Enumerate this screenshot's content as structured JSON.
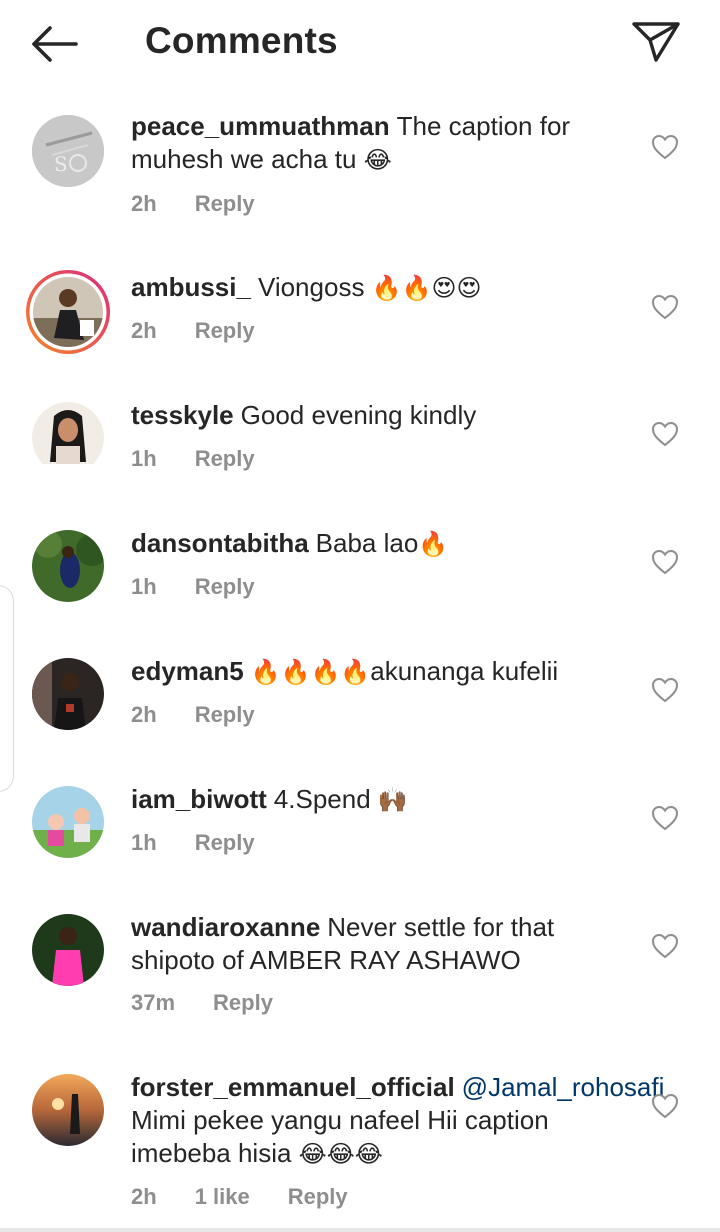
{
  "header": {
    "title": "Comments"
  },
  "comments": [
    {
      "username": "peace_ummuathman",
      "text": "The caption for muhesh we acha tu",
      "emoji": "😂",
      "time": "2h",
      "reply": "Reply"
    },
    {
      "username": "ambussi_",
      "text": "Viongoss",
      "emoji": "🔥🔥😍😍",
      "time": "2h",
      "reply": "Reply"
    },
    {
      "username": "tesskyle",
      "text": "Good evening kindly",
      "emoji": "",
      "time": "1h",
      "reply": "Reply"
    },
    {
      "username": "dansontabitha",
      "text": "Baba lao",
      "emoji": "🔥",
      "time": "1h",
      "reply": "Reply"
    },
    {
      "username": "edyman5",
      "emoji_before": "🔥🔥🔥🔥",
      "text": "akunanga kufelii",
      "time": "2h",
      "reply": "Reply"
    },
    {
      "username": "iam_biwott",
      "text": "4.Spend",
      "emoji": "🙌🏾",
      "time": "1h",
      "reply": "Reply"
    },
    {
      "username": "wandiaroxanne",
      "text": "Never settle  for that shipoto of  AMBER RAY ASHAWO",
      "emoji": "",
      "time": "37m",
      "reply": "Reply"
    },
    {
      "username": "forster_emmanuel_official",
      "mention": "@Jamal_rohosafi",
      "text": "Mimi pekee yangu nafeel Hii caption imebeba hisia",
      "emoji": "😂😂😂",
      "time": "2h",
      "likes": "1 like",
      "reply": "Reply"
    }
  ],
  "colors": {
    "text": "#262626",
    "meta": "#8e8e8e",
    "mention": "#00376b",
    "story_ring_start": "#f58529",
    "story_ring_end": "#dd2a7b"
  },
  "icons": {
    "back": "arrow-left-icon",
    "send": "paper-plane-icon",
    "like": "heart-outline-icon"
  }
}
